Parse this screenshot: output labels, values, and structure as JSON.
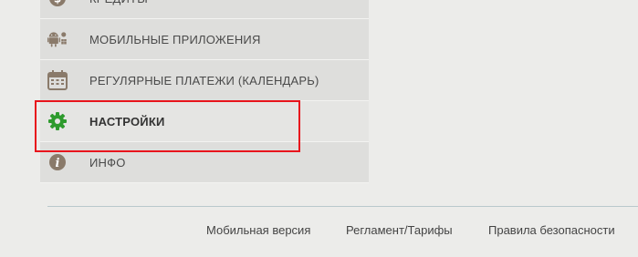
{
  "menu": {
    "items": [
      {
        "label": "КРЕДИТЫ",
        "icon": "coin-dollar-icon"
      },
      {
        "label": "МОБИЛЬНЫЕ ПРИЛОЖЕНИЯ",
        "icon": "mobile-platforms-icon"
      },
      {
        "label": "РЕГУЛЯРНЫЕ ПЛАТЕЖИ (КАЛЕНДАРЬ)",
        "icon": "calendar-icon"
      },
      {
        "label": "НАСТРОЙКИ",
        "icon": "gear-icon",
        "active": true
      },
      {
        "label": "ИНФО",
        "icon": "info-icon"
      }
    ]
  },
  "highlight_color": "#e8141c",
  "footer": {
    "links": [
      {
        "label": "Мобильная версия"
      },
      {
        "label": "Регламент/Тарифы"
      },
      {
        "label": "Правила безопасности"
      }
    ]
  },
  "colors": {
    "background": "#ececea",
    "menu_item_bg": "#dededc",
    "gear_icon": "#2e9b2e",
    "icon_brown": "#8a7a6a"
  }
}
